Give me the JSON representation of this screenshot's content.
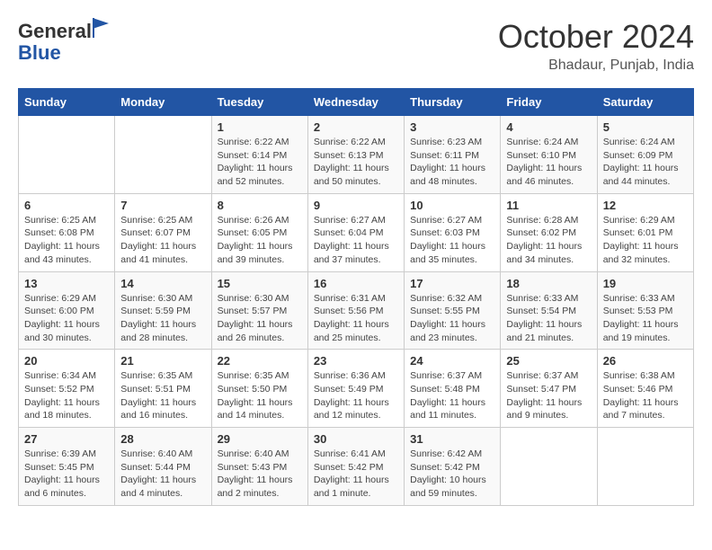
{
  "header": {
    "logo_line1": "General",
    "logo_line2": "Blue",
    "month": "October 2024",
    "location": "Bhadaur, Punjab, India"
  },
  "days_of_week": [
    "Sunday",
    "Monday",
    "Tuesday",
    "Wednesday",
    "Thursday",
    "Friday",
    "Saturday"
  ],
  "weeks": [
    [
      {
        "day": "",
        "info": ""
      },
      {
        "day": "",
        "info": ""
      },
      {
        "day": "1",
        "info": "Sunrise: 6:22 AM\nSunset: 6:14 PM\nDaylight: 11 hours and 52 minutes."
      },
      {
        "day": "2",
        "info": "Sunrise: 6:22 AM\nSunset: 6:13 PM\nDaylight: 11 hours and 50 minutes."
      },
      {
        "day": "3",
        "info": "Sunrise: 6:23 AM\nSunset: 6:11 PM\nDaylight: 11 hours and 48 minutes."
      },
      {
        "day": "4",
        "info": "Sunrise: 6:24 AM\nSunset: 6:10 PM\nDaylight: 11 hours and 46 minutes."
      },
      {
        "day": "5",
        "info": "Sunrise: 6:24 AM\nSunset: 6:09 PM\nDaylight: 11 hours and 44 minutes."
      }
    ],
    [
      {
        "day": "6",
        "info": "Sunrise: 6:25 AM\nSunset: 6:08 PM\nDaylight: 11 hours and 43 minutes."
      },
      {
        "day": "7",
        "info": "Sunrise: 6:25 AM\nSunset: 6:07 PM\nDaylight: 11 hours and 41 minutes."
      },
      {
        "day": "8",
        "info": "Sunrise: 6:26 AM\nSunset: 6:05 PM\nDaylight: 11 hours and 39 minutes."
      },
      {
        "day": "9",
        "info": "Sunrise: 6:27 AM\nSunset: 6:04 PM\nDaylight: 11 hours and 37 minutes."
      },
      {
        "day": "10",
        "info": "Sunrise: 6:27 AM\nSunset: 6:03 PM\nDaylight: 11 hours and 35 minutes."
      },
      {
        "day": "11",
        "info": "Sunrise: 6:28 AM\nSunset: 6:02 PM\nDaylight: 11 hours and 34 minutes."
      },
      {
        "day": "12",
        "info": "Sunrise: 6:29 AM\nSunset: 6:01 PM\nDaylight: 11 hours and 32 minutes."
      }
    ],
    [
      {
        "day": "13",
        "info": "Sunrise: 6:29 AM\nSunset: 6:00 PM\nDaylight: 11 hours and 30 minutes."
      },
      {
        "day": "14",
        "info": "Sunrise: 6:30 AM\nSunset: 5:59 PM\nDaylight: 11 hours and 28 minutes."
      },
      {
        "day": "15",
        "info": "Sunrise: 6:30 AM\nSunset: 5:57 PM\nDaylight: 11 hours and 26 minutes."
      },
      {
        "day": "16",
        "info": "Sunrise: 6:31 AM\nSunset: 5:56 PM\nDaylight: 11 hours and 25 minutes."
      },
      {
        "day": "17",
        "info": "Sunrise: 6:32 AM\nSunset: 5:55 PM\nDaylight: 11 hours and 23 minutes."
      },
      {
        "day": "18",
        "info": "Sunrise: 6:33 AM\nSunset: 5:54 PM\nDaylight: 11 hours and 21 minutes."
      },
      {
        "day": "19",
        "info": "Sunrise: 6:33 AM\nSunset: 5:53 PM\nDaylight: 11 hours and 19 minutes."
      }
    ],
    [
      {
        "day": "20",
        "info": "Sunrise: 6:34 AM\nSunset: 5:52 PM\nDaylight: 11 hours and 18 minutes."
      },
      {
        "day": "21",
        "info": "Sunrise: 6:35 AM\nSunset: 5:51 PM\nDaylight: 11 hours and 16 minutes."
      },
      {
        "day": "22",
        "info": "Sunrise: 6:35 AM\nSunset: 5:50 PM\nDaylight: 11 hours and 14 minutes."
      },
      {
        "day": "23",
        "info": "Sunrise: 6:36 AM\nSunset: 5:49 PM\nDaylight: 11 hours and 12 minutes."
      },
      {
        "day": "24",
        "info": "Sunrise: 6:37 AM\nSunset: 5:48 PM\nDaylight: 11 hours and 11 minutes."
      },
      {
        "day": "25",
        "info": "Sunrise: 6:37 AM\nSunset: 5:47 PM\nDaylight: 11 hours and 9 minutes."
      },
      {
        "day": "26",
        "info": "Sunrise: 6:38 AM\nSunset: 5:46 PM\nDaylight: 11 hours and 7 minutes."
      }
    ],
    [
      {
        "day": "27",
        "info": "Sunrise: 6:39 AM\nSunset: 5:45 PM\nDaylight: 11 hours and 6 minutes."
      },
      {
        "day": "28",
        "info": "Sunrise: 6:40 AM\nSunset: 5:44 PM\nDaylight: 11 hours and 4 minutes."
      },
      {
        "day": "29",
        "info": "Sunrise: 6:40 AM\nSunset: 5:43 PM\nDaylight: 11 hours and 2 minutes."
      },
      {
        "day": "30",
        "info": "Sunrise: 6:41 AM\nSunset: 5:42 PM\nDaylight: 11 hours and 1 minute."
      },
      {
        "day": "31",
        "info": "Sunrise: 6:42 AM\nSunset: 5:42 PM\nDaylight: 10 hours and 59 minutes."
      },
      {
        "day": "",
        "info": ""
      },
      {
        "day": "",
        "info": ""
      }
    ]
  ]
}
